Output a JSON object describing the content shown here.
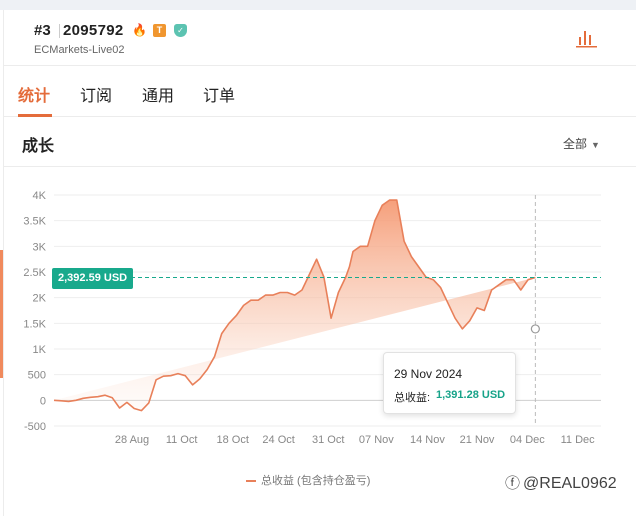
{
  "account": {
    "rank": "#3",
    "id": "2095792",
    "server": "ECMarkets-Live02",
    "badges": [
      {
        "name": "fire-badge-icon",
        "glyph": "🔥",
        "color": "#f07a3a"
      },
      {
        "name": "trader-badge-icon",
        "glyph": "T",
        "color": "#f0962f"
      },
      {
        "name": "verified-shield-icon",
        "glyph": "✓",
        "color": "#5cc3b1"
      }
    ]
  },
  "tabs": [
    {
      "label": "统计",
      "active": true
    },
    {
      "label": "订阅",
      "active": false
    },
    {
      "label": "通用",
      "active": false
    },
    {
      "label": "订单",
      "active": false
    }
  ],
  "section": {
    "title": "成长",
    "range_label": "全部"
  },
  "tooltip": {
    "date": "29 Nov 2024",
    "label": "总收益:",
    "value": "1,391.28 USD"
  },
  "current_badge": "2,392.59 USD",
  "legend_label": "总收益 (包含持仓盈亏)",
  "watermark": "@REAL0962",
  "colors": {
    "accent": "#e46c3b",
    "line": "#e8805a",
    "area_top": "#f7a07e",
    "teal": "#18a98c"
  },
  "chart_data": {
    "type": "area",
    "series": [
      {
        "name": "总收益 (包含持仓盈亏)"
      }
    ],
    "ylim": [
      -500,
      4000
    ],
    "ytick_labels": [
      "4K",
      "3.5K",
      "3K",
      "2.5K",
      "2K",
      "1.5K",
      "1K",
      "500",
      "0",
      "-500"
    ],
    "ytick_values": [
      4000,
      3500,
      3000,
      2500,
      2000,
      1500,
      1000,
      500,
      0,
      -500
    ],
    "xtick_labels": [
      "28 Aug",
      "11 Oct",
      "18 Oct",
      "24 Oct",
      "31 Oct",
      "07 Nov",
      "14 Nov",
      "21 Nov",
      "04 Dec",
      "11 Dec"
    ],
    "xtick_values": [
      10.7,
      17.5,
      24.5,
      30.8,
      37.6,
      44.2,
      51.2,
      58,
      64.9,
      71.8
    ],
    "x": [
      0,
      1,
      2,
      3,
      4,
      5,
      6,
      7,
      8,
      9,
      10,
      11,
      12,
      13,
      14,
      15,
      16,
      17,
      18,
      19,
      20,
      21,
      22,
      23,
      24,
      25,
      26,
      27,
      28,
      29,
      30,
      31,
      32,
      33,
      34,
      35,
      36,
      37,
      38,
      39,
      40,
      40.5,
      41,
      42,
      43,
      44,
      45,
      46,
      47,
      48,
      49,
      50,
      51,
      52,
      53,
      54,
      55,
      56,
      57,
      58,
      59,
      60,
      61,
      62,
      63,
      64,
      65,
      66,
      67,
      68,
      69,
      70,
      71,
      72,
      73,
      74,
      75
    ],
    "values": [
      0,
      -10,
      -20,
      0,
      40,
      60,
      70,
      100,
      50,
      -150,
      -40,
      -160,
      -200,
      -50,
      400,
      470,
      480,
      520,
      480,
      300,
      420,
      600,
      850,
      1300,
      1500,
      1650,
      1850,
      1950,
      1950,
      2050,
      2050,
      2100,
      2100,
      2050,
      2150,
      2450,
      2750,
      2400,
      1600,
      2100,
      2400,
      2600,
      2900,
      3000,
      3000,
      3500,
      3800,
      3900,
      3900,
      3100,
      2800,
      2600,
      2400,
      2350,
      2200,
      1900,
      1600,
      1391.28,
      1550,
      1800,
      1750,
      2150,
      2250,
      2350,
      2350,
      2150,
      2350,
      2392.59
    ],
    "current_value": 2392.59,
    "highlight": {
      "x": 66,
      "y": 1391.28,
      "date": "29 Nov 2024"
    },
    "grid": true,
    "legend": "bottom"
  }
}
